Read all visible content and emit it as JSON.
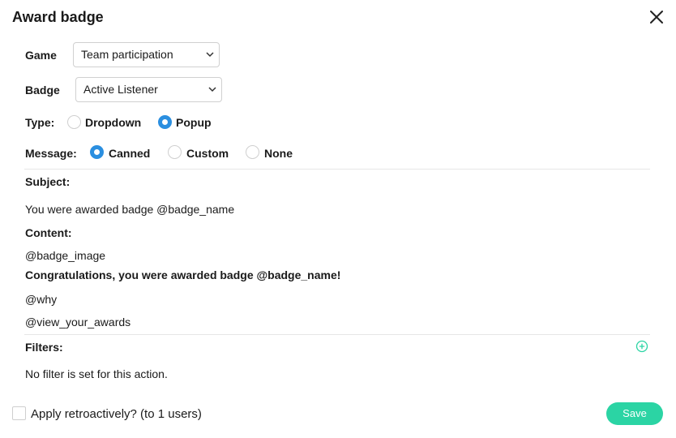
{
  "dialog": {
    "title": "Award badge"
  },
  "game": {
    "label": "Game",
    "value": "Team participation"
  },
  "badge": {
    "label": "Badge",
    "value": "Active Listener"
  },
  "type": {
    "label": "Type:",
    "options": [
      "Dropdown",
      "Popup"
    ],
    "selected": "Popup"
  },
  "message": {
    "label": "Message:",
    "options": [
      "Canned",
      "Custom",
      "None"
    ],
    "selected": "Canned"
  },
  "subject": {
    "label": "Subject:",
    "value": "You were awarded badge @badge_name"
  },
  "content": {
    "label": "Content:",
    "lines": [
      "@badge_image",
      "Congratulations, you were awarded badge @badge_name!",
      "@why",
      "@view_your_awards"
    ]
  },
  "filters": {
    "label": "Filters:",
    "empty_text": "No filter is set for this action."
  },
  "footer": {
    "retro_label": "Apply retroactively? (to 1 users)",
    "save_label": "Save"
  },
  "colors": {
    "accent_green": "#2bd4a4",
    "radio_blue": "#2b8fe0"
  }
}
